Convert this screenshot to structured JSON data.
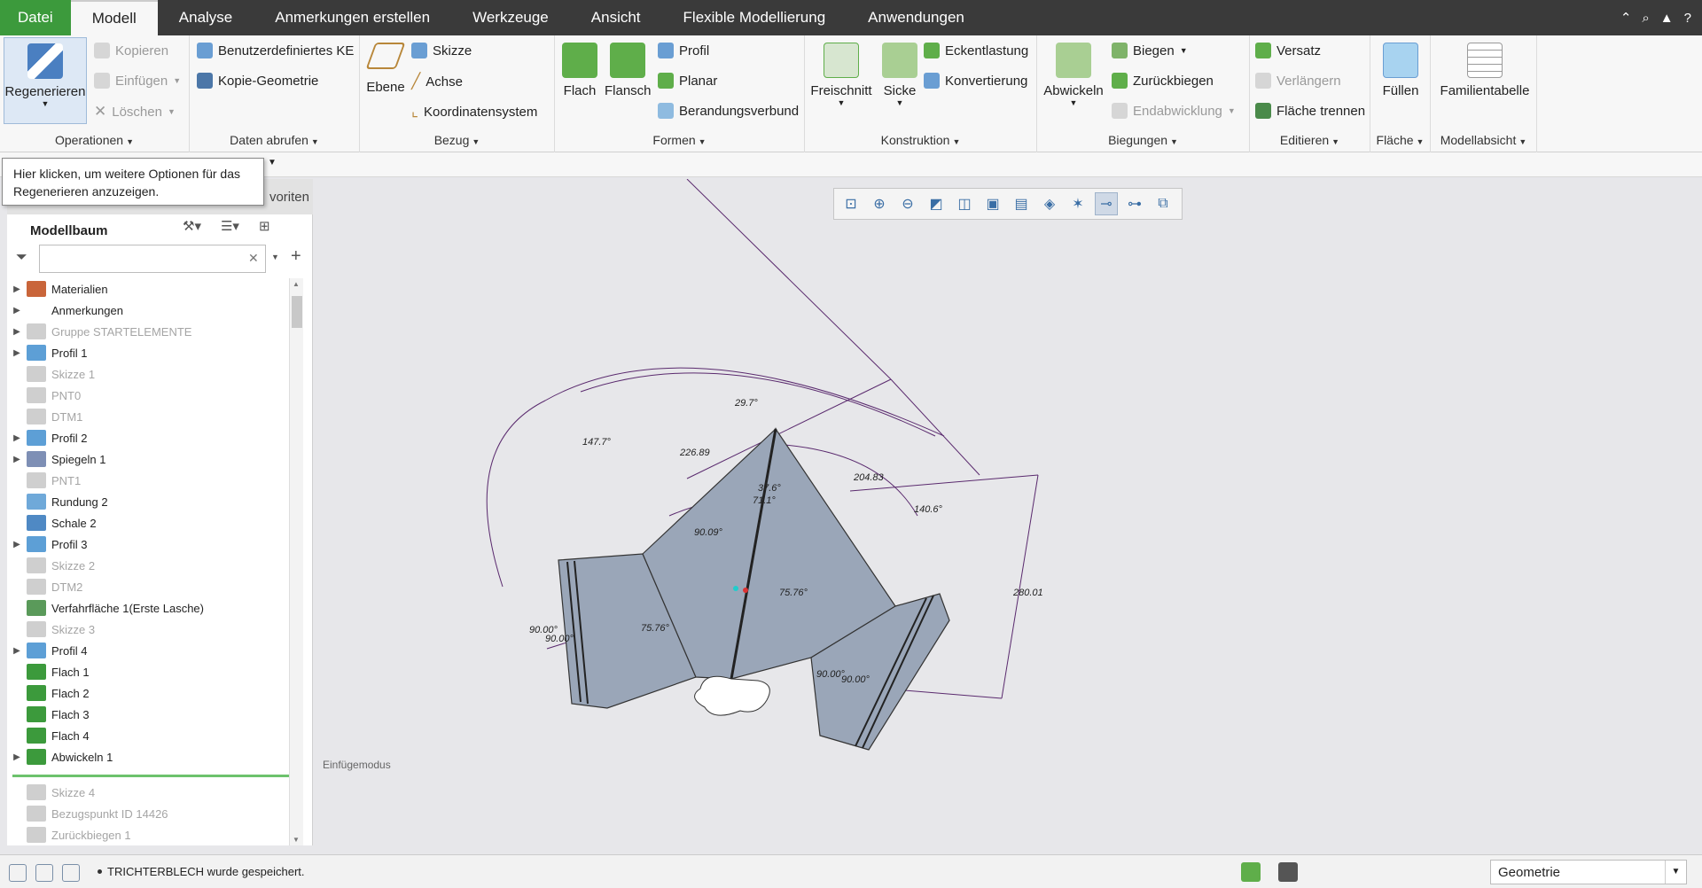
{
  "menu": {
    "tabs": [
      "Datei",
      "Modell",
      "Analyse",
      "Anmerkungen erstellen",
      "Werkzeuge",
      "Ansicht",
      "Flexible Modellierung",
      "Anwendungen"
    ],
    "active": "Modell"
  },
  "ribbon": {
    "operationen": {
      "label": "Operationen",
      "regenerieren": "Regenerieren",
      "kopieren": "Kopieren",
      "einfuegen": "Einfügen",
      "loeschen": "Löschen"
    },
    "daten": {
      "label": "Daten abrufen",
      "benutzer": "Benutzerdefiniertes KE",
      "kopie": "Kopie-Geometrie"
    },
    "bezug": {
      "label": "Bezug",
      "ebene": "Ebene",
      "skizze": "Skizze",
      "achse": "Achse",
      "koord": "Koordinatensystem"
    },
    "formen": {
      "label": "Formen",
      "flach": "Flach",
      "flansch": "Flansch",
      "profil": "Profil",
      "planar": "Planar",
      "berandung": "Berandungsverbund"
    },
    "konstruktion": {
      "label": "Konstruktion",
      "freischnitt": "Freischnitt",
      "sicke": "Sicke",
      "ecke": "Eckentlastung",
      "konv": "Konvertierung"
    },
    "biegungen": {
      "label": "Biegungen",
      "abwickeln": "Abwickeln",
      "biegen": "Biegen",
      "zurueck": "Zurückbiegen",
      "endab": "Endabwicklung"
    },
    "editieren": {
      "label": "Editieren",
      "versatz": "Versatz",
      "verlaengern": "Verlängern",
      "flaeche_trennen": "Fläche trennen"
    },
    "flaeche": {
      "label": "Fläche",
      "fuellen": "Füllen"
    },
    "modellabsicht": {
      "label": "Modellabsicht",
      "familie": "Familientabelle"
    }
  },
  "tooltip": "Hier klicken, um weitere Optionen für das Regenerieren anzuzeigen.",
  "left_panel": {
    "tab_partial": "voriten",
    "title": "Modellbaum",
    "search_placeholder": "",
    "items": [
      {
        "label": "Materialien",
        "expand": true,
        "dim": false,
        "color": "#c9653a"
      },
      {
        "label": "Anmerkungen",
        "expand": true,
        "dim": false,
        "color": "#ffffff"
      },
      {
        "label": "Gruppe STARTELEMENTE",
        "expand": true,
        "dim": true,
        "color": "#cfcfcf"
      },
      {
        "label": "Profil 1",
        "expand": true,
        "dim": false,
        "color": "#5d9fd6"
      },
      {
        "label": "Skizze 1",
        "expand": false,
        "dim": true,
        "color": "#cfcfcf"
      },
      {
        "label": "PNT0",
        "expand": false,
        "dim": true,
        "color": "#cfcfcf"
      },
      {
        "label": "DTM1",
        "expand": false,
        "dim": true,
        "color": "#cfcfcf"
      },
      {
        "label": "Profil 2",
        "expand": true,
        "dim": false,
        "color": "#5d9fd6"
      },
      {
        "label": "Spiegeln 1",
        "expand": true,
        "dim": false,
        "color": "#7e8fb5"
      },
      {
        "label": "PNT1",
        "expand": false,
        "dim": true,
        "color": "#cfcfcf"
      },
      {
        "label": "Rundung 2",
        "expand": false,
        "dim": false,
        "color": "#6fa9d9"
      },
      {
        "label": "Schale 2",
        "expand": false,
        "dim": false,
        "color": "#4f89c4"
      },
      {
        "label": "Profil 3",
        "expand": true,
        "dim": false,
        "color": "#5d9fd6"
      },
      {
        "label": "Skizze 2",
        "expand": false,
        "dim": true,
        "color": "#cfcfcf"
      },
      {
        "label": "DTM2",
        "expand": false,
        "dim": true,
        "color": "#cfcfcf"
      },
      {
        "label": "Verfahrfläche 1(Erste Lasche)",
        "expand": false,
        "dim": false,
        "color": "#5a9a5a"
      },
      {
        "label": "Skizze 3",
        "expand": false,
        "dim": true,
        "color": "#cfcfcf"
      },
      {
        "label": "Profil 4",
        "expand": true,
        "dim": false,
        "color": "#5d9fd6"
      },
      {
        "label": "Flach 1",
        "expand": false,
        "dim": false,
        "color": "#3c9a3c"
      },
      {
        "label": "Flach 2",
        "expand": false,
        "dim": false,
        "color": "#3c9a3c"
      },
      {
        "label": "Flach 3",
        "expand": false,
        "dim": false,
        "color": "#3c9a3c"
      },
      {
        "label": "Flach 4",
        "expand": false,
        "dim": false,
        "color": "#3c9a3c"
      },
      {
        "label": "Abwickeln 1",
        "expand": true,
        "dim": false,
        "color": "#3c9a3c"
      }
    ],
    "after_insert": [
      {
        "label": "Skizze 4",
        "color": "#cfcfcf"
      },
      {
        "label": "Bezugspunkt ID 14426",
        "color": "#cfcfcf"
      },
      {
        "label": "Zurückbiegen 1",
        "color": "#cfcfcf"
      }
    ]
  },
  "viewport": {
    "mode": "Einfügemodus",
    "dims": [
      "29.7°",
      "147.7°",
      "226.89",
      "37.6°",
      "71.1°",
      "204.83",
      "140.6°",
      "90.09°",
      "280.01",
      "90.00°",
      "90.00°",
      "75.76°",
      "75.76°",
      "90.00°",
      "90.00°"
    ]
  },
  "status": {
    "message": "TRICHTERBLECH wurde gespeichert.",
    "filter": "Geometrie"
  }
}
